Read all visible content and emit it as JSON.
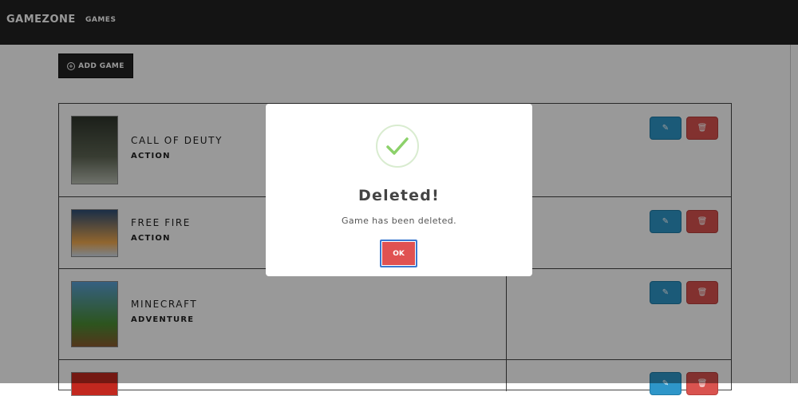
{
  "navbar": {
    "brand": "GAMEZONE",
    "links": [
      "GAMES"
    ]
  },
  "toolbar": {
    "add_label": "ADD GAME",
    "add_icon": "plus-circle-icon"
  },
  "games": [
    {
      "title": "CALL OF DEUTY",
      "genre": "ACTION",
      "thumb_colors": [
        "#2f352c",
        "#5e6654",
        "#b8bdb2"
      ]
    },
    {
      "title": "FREE FIRE",
      "genre": "ACTION",
      "thumb_colors": [
        "#2c4e78",
        "#f1a94e",
        "#d0dbe8"
      ]
    },
    {
      "title": "MINECRAFT",
      "genre": "ADVENTURE",
      "thumb_colors": [
        "#5aa0d6",
        "#4b8d33",
        "#8b5b2f"
      ]
    },
    {
      "title": "",
      "genre": "",
      "thumb_colors": [
        "#c2281f",
        "#ffffff",
        "#ffffff"
      ]
    }
  ],
  "actions": {
    "edit_icon": "pencil-icon",
    "delete_icon": "trash-icon"
  },
  "modal": {
    "title": "Deleted!",
    "text": "Game has been deleted.",
    "ok_label": "OK",
    "icon": "success-check-icon"
  },
  "colors": {
    "navbar": "#222222",
    "edit": "#2e96c9",
    "delete": "#d9534f",
    "ok": "#e05252",
    "success": "#8cd16a"
  }
}
